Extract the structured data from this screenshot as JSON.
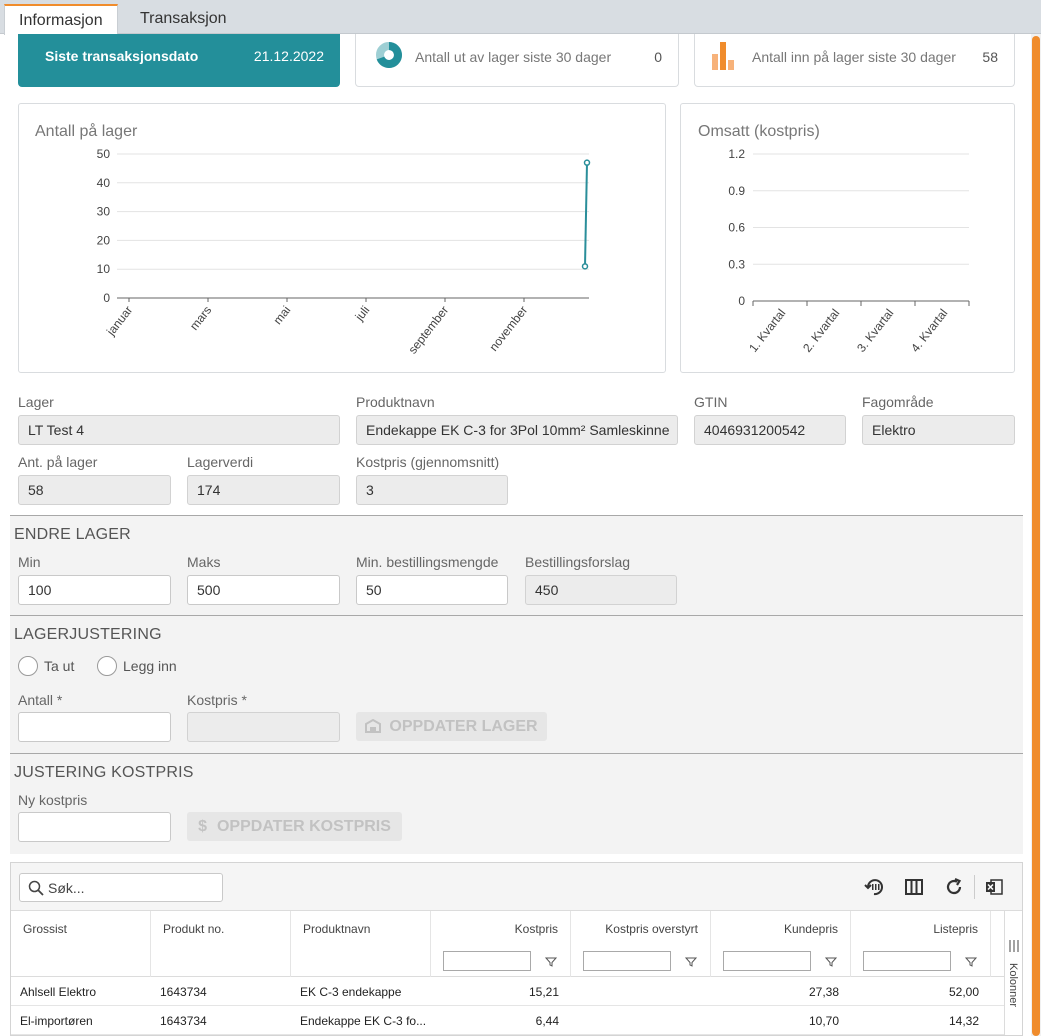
{
  "tabs": [
    {
      "label": "Informasjon"
    },
    {
      "label": "Transaksjon"
    }
  ],
  "kpis": {
    "last_tx": {
      "label": "Siste transaksjonsdato",
      "value": "21.12.2022"
    },
    "out_30": {
      "label": "Antall ut av lager siste 30 dager",
      "value": "0"
    },
    "in_30": {
      "label": "Antall inn på lager siste 30 dager",
      "value": "58"
    }
  },
  "colors": {
    "teal": "#238f9a",
    "orange": "#f08c2c",
    "line": "#2a8e9a"
  },
  "chart_data": [
    {
      "type": "line",
      "title": "Antall på lager",
      "x": [
        "januar",
        "mars",
        "mai",
        "juli",
        "september",
        "november"
      ],
      "ylim": [
        0,
        50
      ],
      "yticks": [
        0,
        10,
        20,
        30,
        40,
        50
      ],
      "grid": true,
      "series": [
        {
          "points": [
            {
              "x": "desember",
              "y": 11
            },
            {
              "x": "desember",
              "y": 47
            }
          ]
        }
      ]
    },
    {
      "type": "bar",
      "title": "Omsatt (kostpris)",
      "categories": [
        "1. Kvartal",
        "2. Kvartal",
        "3. Kvartal",
        "4. Kvartal"
      ],
      "values": [
        0,
        0,
        0,
        0
      ],
      "ylim": [
        0,
        1.2
      ],
      "yticks": [
        0,
        0.3,
        0.6,
        0.9,
        1.2
      ],
      "grid": true
    }
  ],
  "info": {
    "lager": {
      "label": "Lager",
      "value": "LT Test 4"
    },
    "produktnavn": {
      "label": "Produktnavn",
      "value": "Endekappe EK C-3 for 3Pol 10mm² Samleskinne"
    },
    "gtin": {
      "label": "GTIN",
      "value": "4046931200542"
    },
    "fagomrade": {
      "label": "Fagområde",
      "value": "Elektro"
    },
    "ant_lager": {
      "label": "Ant. på lager",
      "value": "58"
    },
    "lagerverdi": {
      "label": "Lagerverdi",
      "value": "174"
    },
    "kostpris": {
      "label": "Kostpris (gjennomsnitt)",
      "value": "3"
    }
  },
  "endre_lager": {
    "title": "ENDRE LAGER",
    "min": {
      "label": "Min",
      "value": "100"
    },
    "maks": {
      "label": "Maks",
      "value": "500"
    },
    "min_best": {
      "label": "Min. bestillingsmengde",
      "value": "50"
    },
    "forslag": {
      "label": "Bestillingsforslag",
      "value": "450"
    }
  },
  "lagerjustering": {
    "title": "LAGERJUSTERING",
    "radio_out": "Ta ut",
    "radio_in": "Legg inn",
    "antall_label": "Antall *",
    "kostpris_label": "Kostpris *",
    "button": "OPPDATER LAGER"
  },
  "justering_kostpris": {
    "title": "JUSTERING KOSTPRIS",
    "label": "Ny kostpris",
    "button": "OPPDATER KOSTPRIS"
  },
  "grid": {
    "search_placeholder": "Søk...",
    "columns": [
      "Grossist",
      "Produkt no.",
      "Produktnavn",
      "Kostpris",
      "Kostpris overstyrt",
      "Kundepris",
      "Listepris"
    ],
    "side_label": "Kolonner",
    "rows": [
      [
        "Ahlsell Elektro",
        "1643734",
        "EK C-3 endekappe",
        "15,21",
        "",
        "27,38",
        "52,00"
      ],
      [
        "El-importøren",
        "1643734",
        "Endekappe EK C-3 fo...",
        "6,44",
        "",
        "10,70",
        "14,32"
      ]
    ]
  }
}
